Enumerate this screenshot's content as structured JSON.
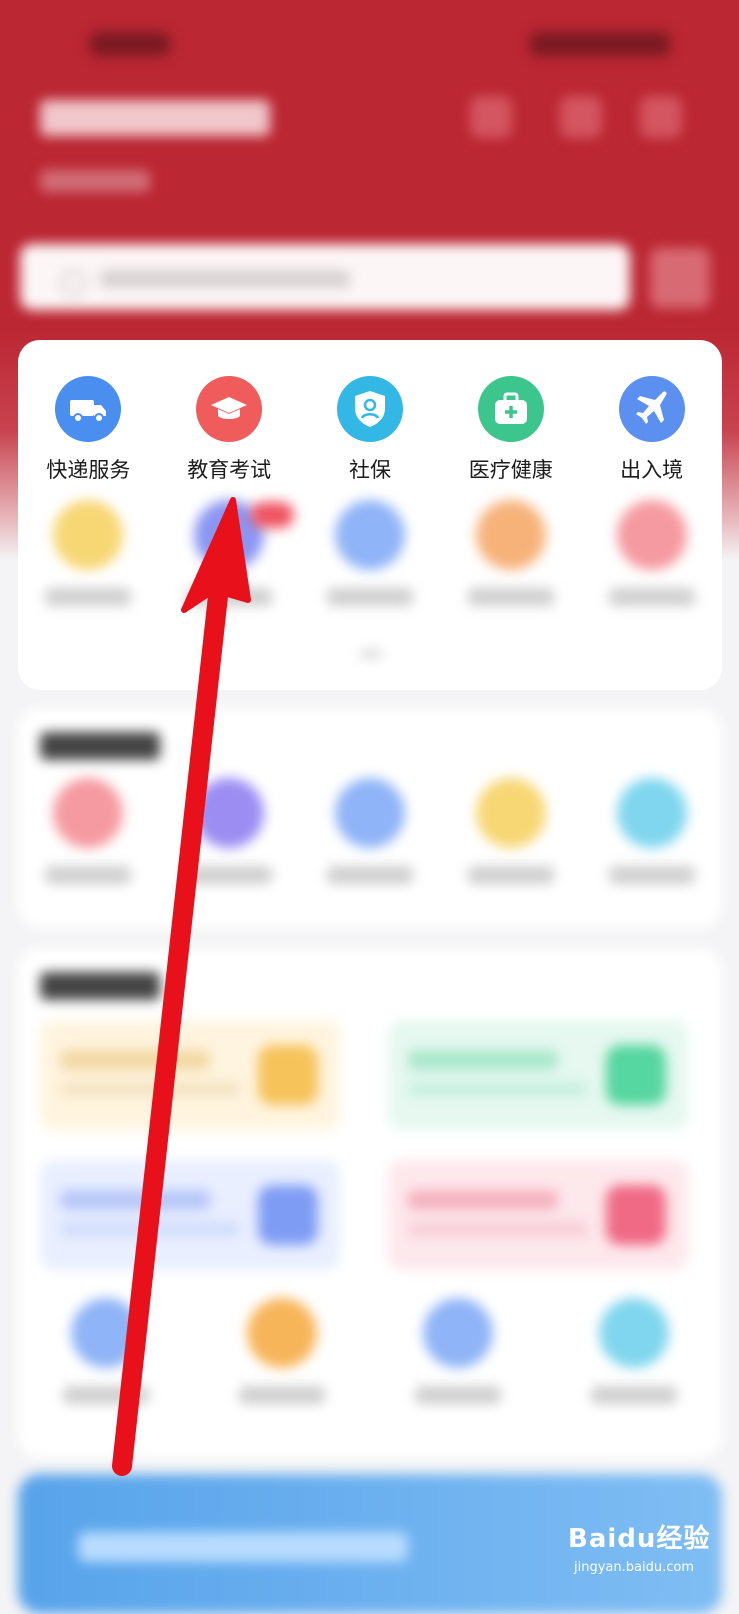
{
  "services": [
    {
      "label": "快递服务",
      "icon": "truck-icon",
      "color": "#4a8ff0"
    },
    {
      "label": "教育考试",
      "icon": "graduation-cap-icon",
      "color": "#f05c5c"
    },
    {
      "label": "社保",
      "icon": "shield-user-icon",
      "color": "#33b8e6"
    },
    {
      "label": "医疗健康",
      "icon": "medical-kit-icon",
      "color": "#3cc68e"
    },
    {
      "label": "出入境",
      "icon": "airplane-icon",
      "color": "#5b8ff0"
    }
  ],
  "blurred_row_colors": [
    "#f7d774",
    "#8b96f3",
    "#8fb4f7",
    "#f7b27a",
    "#f59aa0"
  ],
  "recent_colors": [
    "#f59aa0",
    "#9b8df2",
    "#8fb4f7",
    "#f7d774",
    "#7fd6ee"
  ],
  "hot_tile_colors": [
    {
      "bg": "#fff4df",
      "ic": "#f6c35a"
    },
    {
      "bg": "#e6f8f0",
      "ic": "#56d6a0"
    },
    {
      "bg": "#e9efff",
      "ic": "#7f9cf5"
    },
    {
      "bg": "#fde8ec",
      "ic": "#f06a86"
    }
  ],
  "hot_icon_colors": [
    "#8fb4f7",
    "#f7b55a",
    "#8fb4f7",
    "#7fd6ee"
  ],
  "annotation": {
    "color": "#e8101a"
  },
  "watermark": {
    "main": "Baidu经验",
    "sub": "jingyan.baidu.com"
  },
  "brand_color": "#bb2733"
}
